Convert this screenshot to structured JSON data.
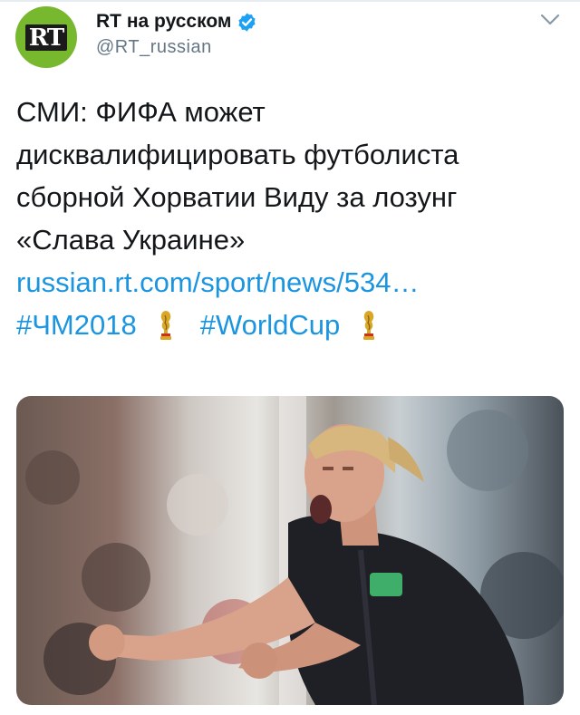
{
  "account": {
    "display_name": "RT на русском",
    "handle": "@RT_russian",
    "avatar_text": "RT",
    "verified": true,
    "avatar_color": "#77b82e"
  },
  "tweet": {
    "lines": [
      "СМИ: ФИФА может",
      "дисквалифицировать футболиста",
      "сборной Хорватии Виду за лозунг",
      "«Слава Украине»"
    ],
    "link": "russian.rt.com/sport/news/534…",
    "hashtags": [
      "#ЧМ2018",
      "#WorldCup"
    ],
    "link_color": "#1b95e0"
  },
  "media": {
    "kind": "photo",
    "description_icon": "football-player-photo"
  },
  "icons": {
    "verified": "verified-badge-icon",
    "menu": "chevron-down-icon",
    "emoji": "world-cup-trophy-icon"
  }
}
